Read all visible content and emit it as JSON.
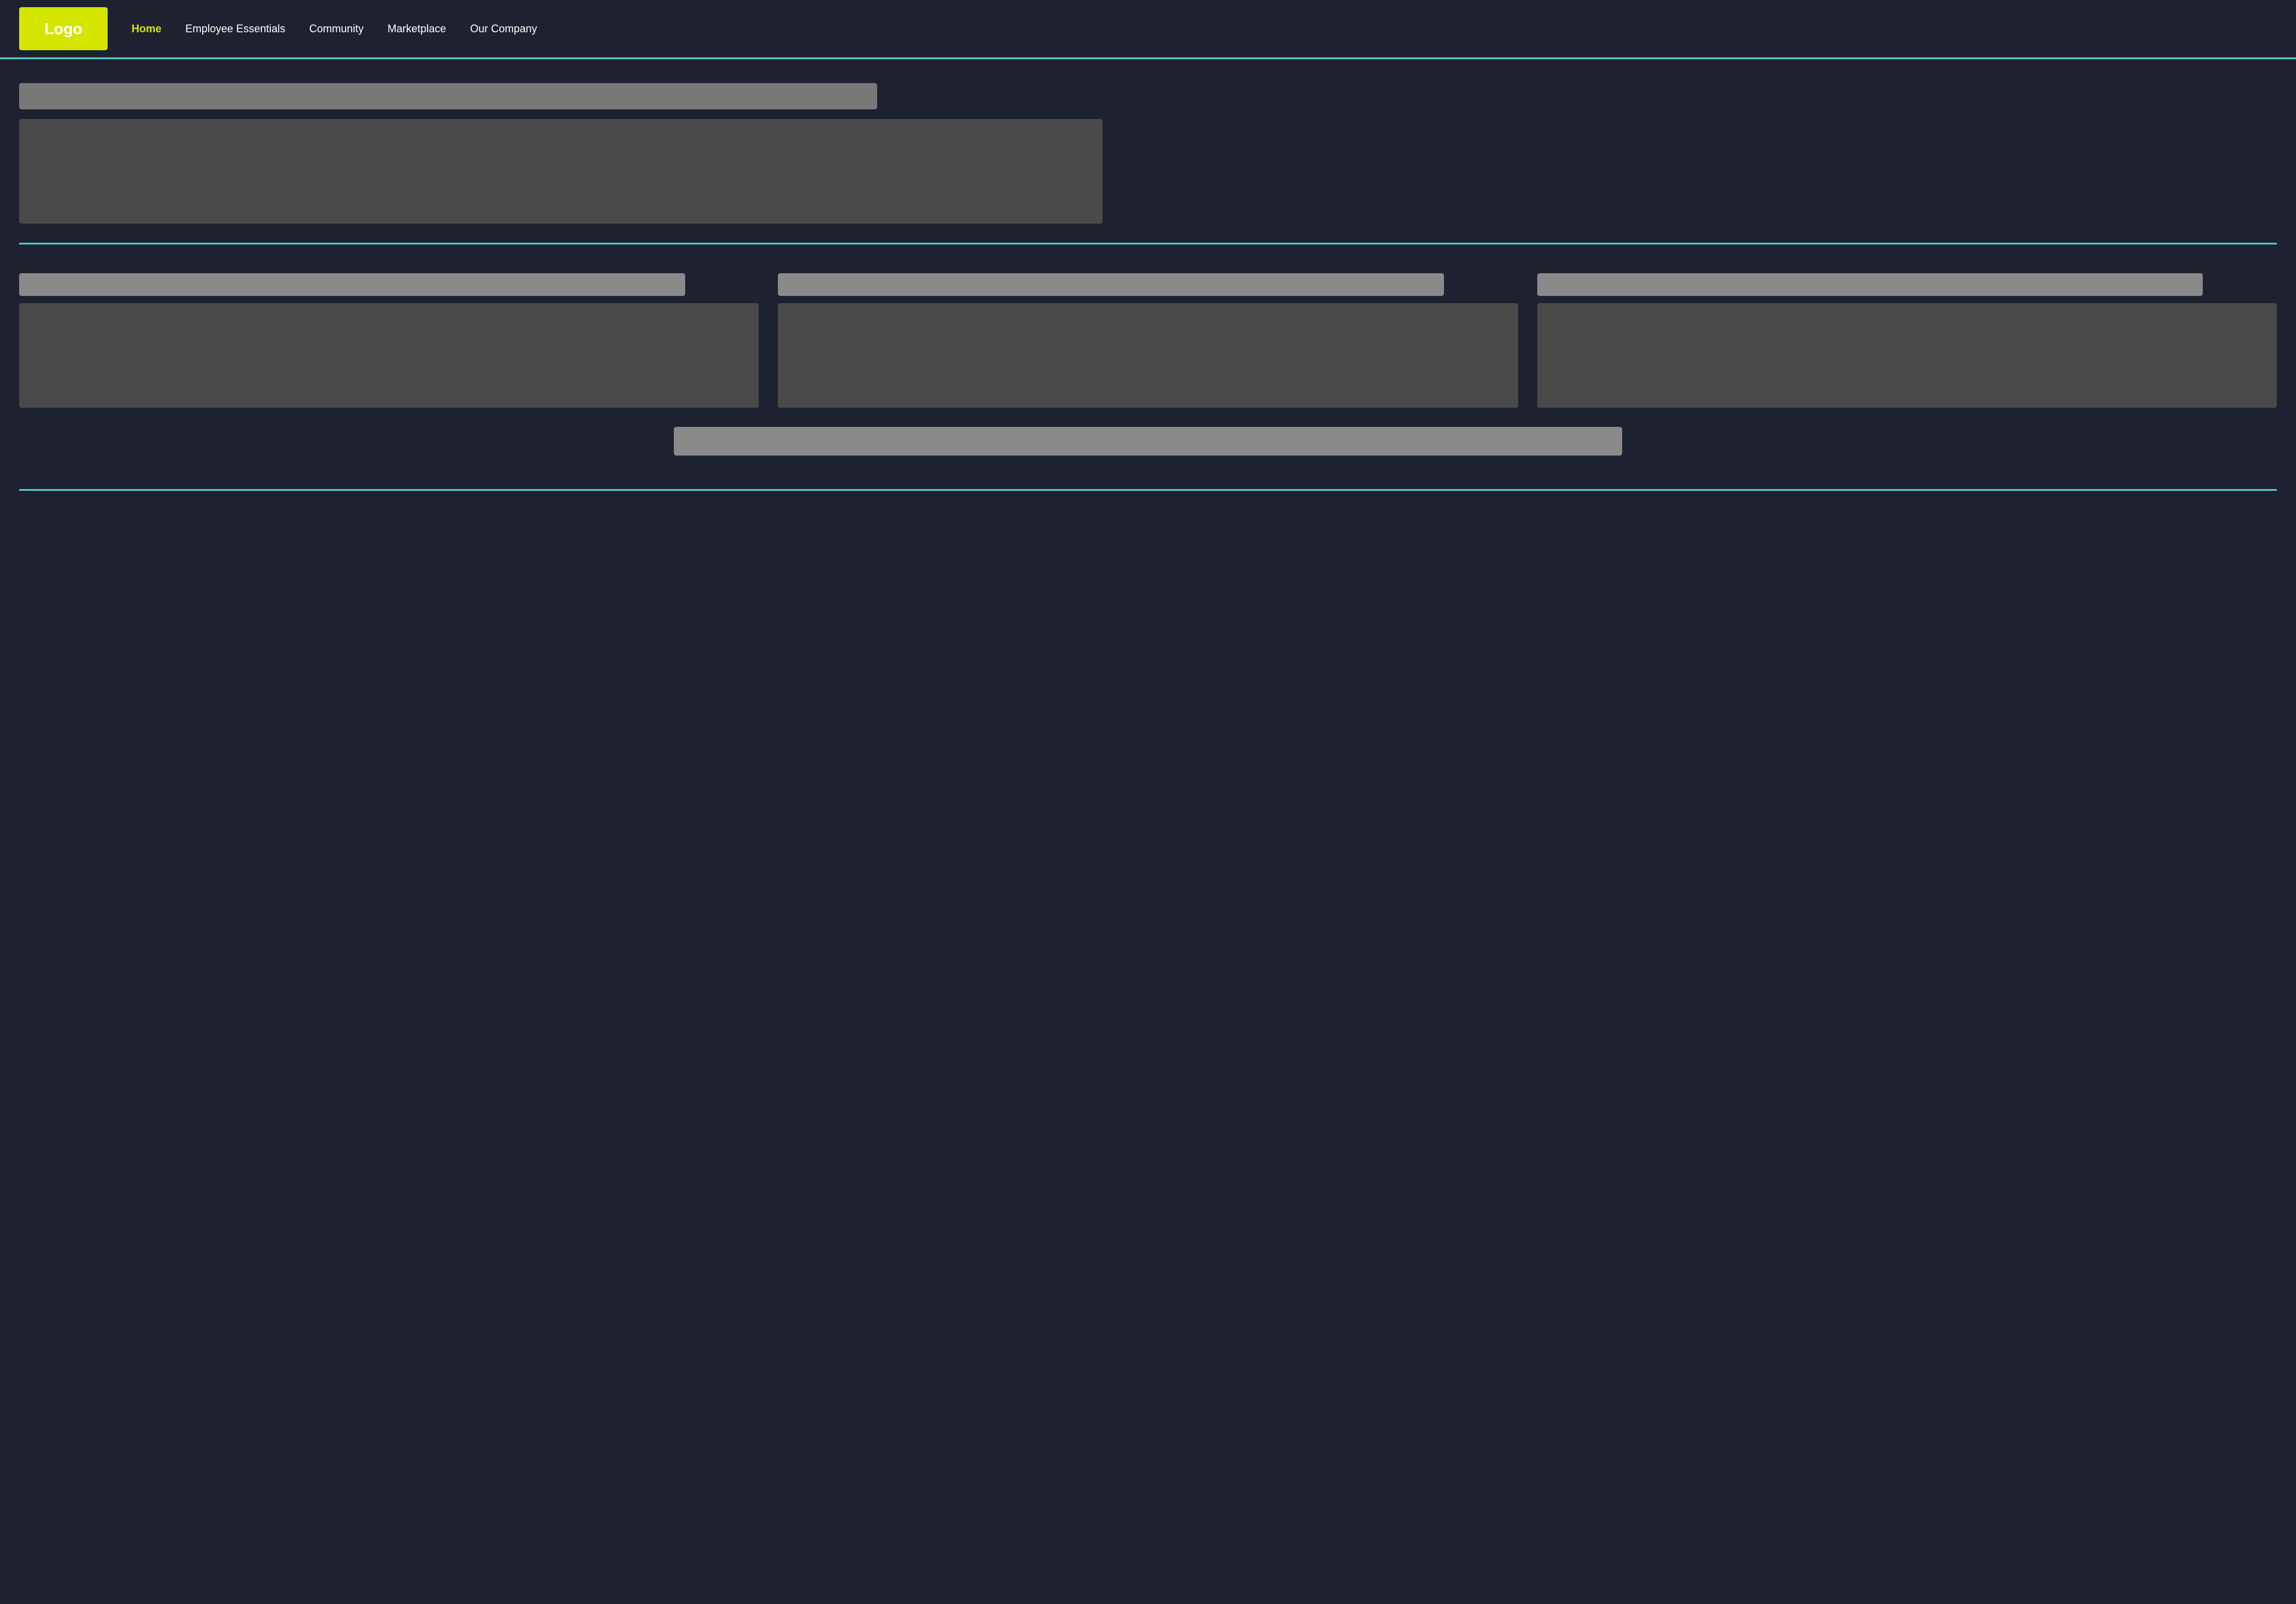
{
  "header": {
    "logo_label": "Logo",
    "nav": {
      "home": "Home",
      "employee_essentials": "Employee Essentials",
      "community": "Community",
      "marketplace": "Marketplace",
      "our_company": "Our Company"
    }
  },
  "hero": {
    "title_placeholder": "",
    "content_placeholder": ""
  },
  "cards": [
    {
      "title_placeholder": "",
      "image_placeholder": ""
    },
    {
      "title_placeholder": "",
      "image_placeholder": ""
    },
    {
      "title_placeholder": "",
      "image_placeholder": ""
    }
  ],
  "cta": {
    "placeholder": ""
  },
  "colors": {
    "accent": "#4ecdc4",
    "logo_bg": "#d4e600",
    "bg": "#1e2130",
    "placeholder_dark": "#4a4a4a",
    "placeholder_light": "#8a8a8a"
  }
}
